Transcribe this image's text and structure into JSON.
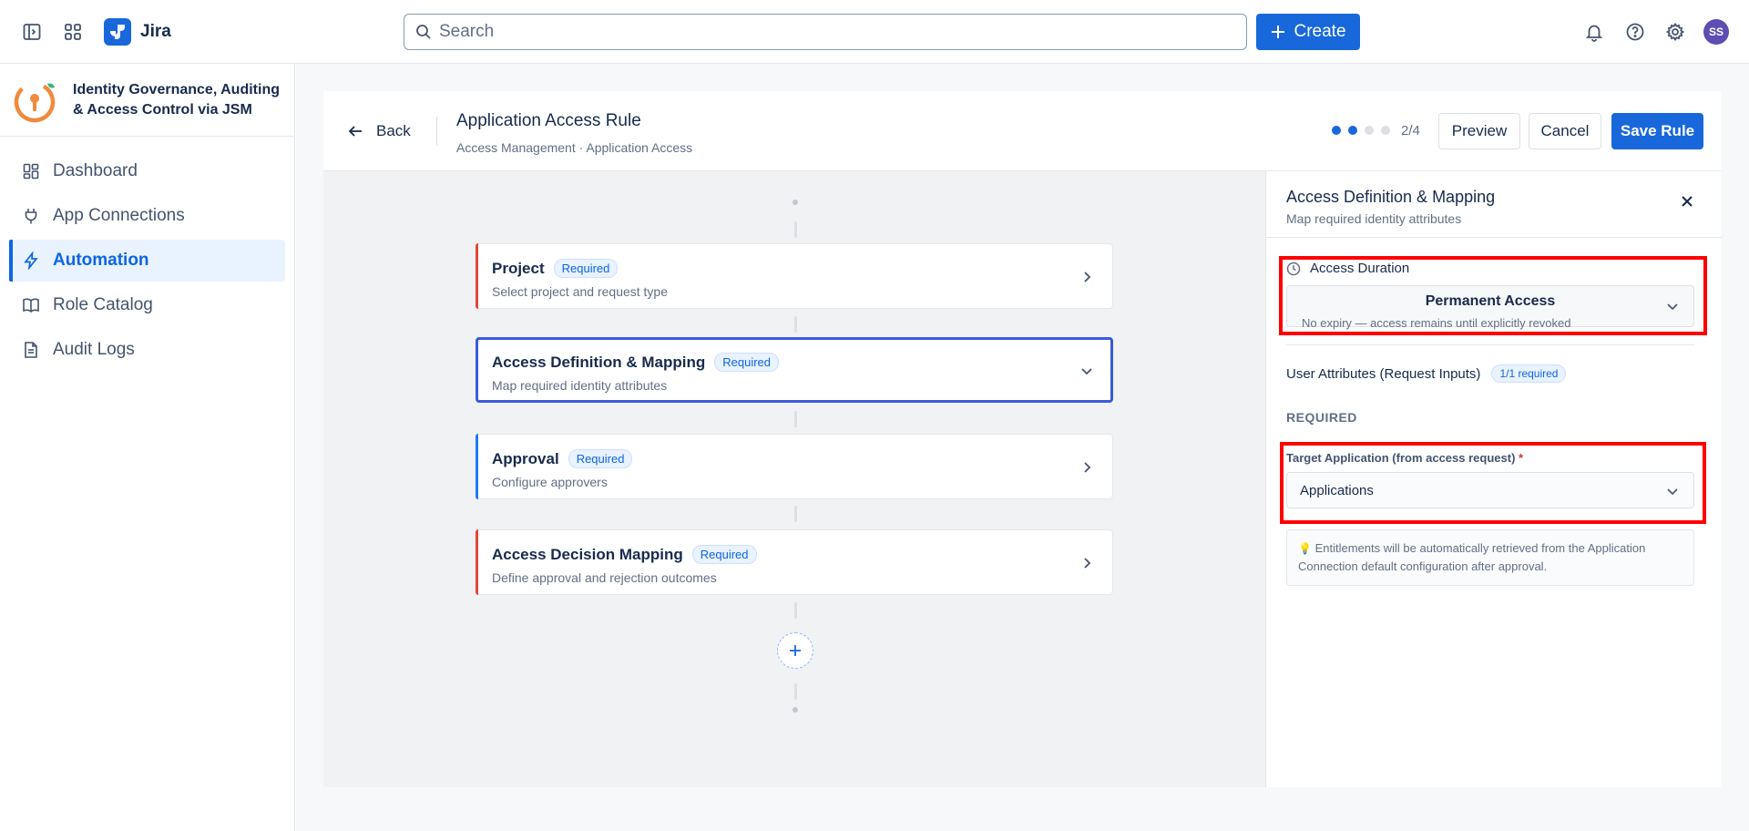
{
  "topbar": {
    "app_name": "Jira",
    "search_placeholder": "Search",
    "create_label": "Create",
    "avatar_initials": "SS"
  },
  "sidebar": {
    "app_title": "Identity Governance, Auditing & Access Control via JSM",
    "items": [
      {
        "label": "Dashboard",
        "icon": "dashboard-icon",
        "active": false
      },
      {
        "label": "App Connections",
        "icon": "plug-icon",
        "active": false
      },
      {
        "label": "Automation",
        "icon": "lightning-icon",
        "active": true
      },
      {
        "label": "Role Catalog",
        "icon": "book-icon",
        "active": false
      },
      {
        "label": "Audit Logs",
        "icon": "document-icon",
        "active": false
      }
    ]
  },
  "rule_header": {
    "back_label": "Back",
    "title": "Application Access Rule",
    "breadcrumb": "Access Management · Application Access",
    "step_indicator": "2/4",
    "steps_total": 4,
    "steps_done": 2,
    "preview_label": "Preview",
    "cancel_label": "Cancel",
    "save_label": "Save Rule"
  },
  "flow": {
    "cards": [
      {
        "title": "Project",
        "badge": "Required",
        "description": "Select project and request type",
        "accent": "#e2483d",
        "selected": false
      },
      {
        "title": "Access Definition & Mapping",
        "badge": "Required",
        "description": "Map required identity attributes",
        "accent": "#3b5bdb",
        "selected": true
      },
      {
        "title": "Approval",
        "badge": "Required",
        "description": "Configure approvers",
        "accent": "#1d7afc",
        "selected": false
      },
      {
        "title": "Access Decision Mapping",
        "badge": "Required",
        "description": "Define approval and rejection outcomes",
        "accent": "#e2483d",
        "selected": false
      }
    ]
  },
  "panel": {
    "title": "Access Definition & Mapping",
    "subtitle": "Map required identity attributes",
    "duration_label": "Access Duration",
    "duration_value": "Permanent Access",
    "duration_desc": "No expiry — access remains until explicitly revoked",
    "attributes_label": "User Attributes (Request Inputs)",
    "attributes_badge": "1/1 required",
    "required_heading": "REQUIRED",
    "target_label": "Target Application (from access request)",
    "target_required_mark": "*",
    "target_value": "Applications",
    "info_icon": "💡",
    "info_text": "Entitlements will be automatically retrieved from the Application Connection default configuration after approval."
  },
  "colors": {
    "primary": "#1868db",
    "highlight": "#ff0000",
    "active_nav_bg": "#e9f2ff"
  }
}
